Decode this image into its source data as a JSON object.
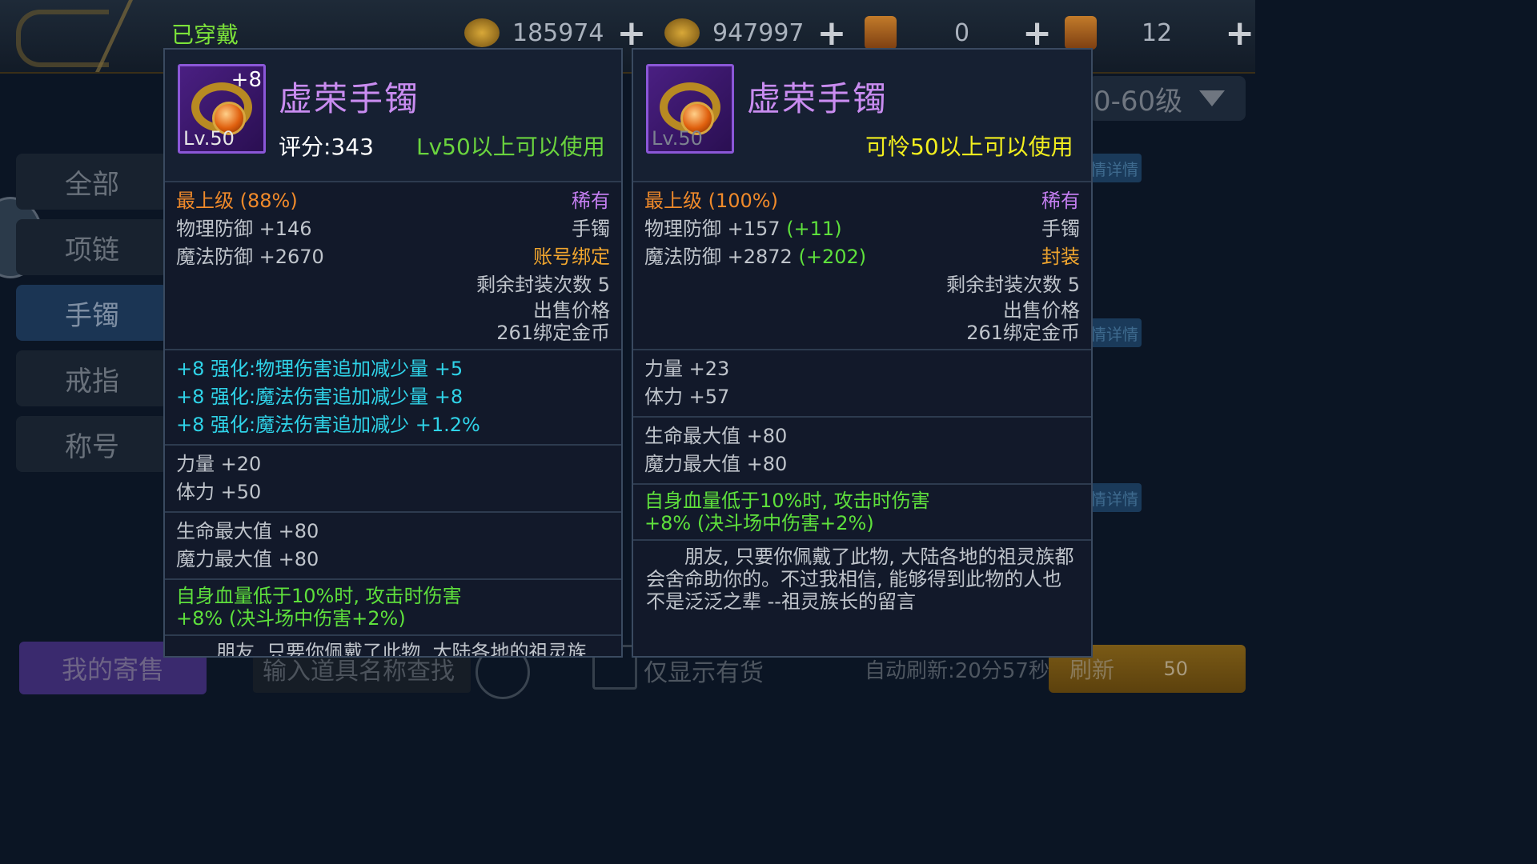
{
  "topbar": {
    "currencies": [
      {
        "icon": "gold-coin-icon",
        "value": "185974"
      },
      {
        "icon": "bound-coin-icon",
        "value": "947997"
      },
      {
        "icon": "scroll-icon",
        "value": "0"
      },
      {
        "icon": "scroll-icon",
        "value": "12"
      }
    ],
    "plus": "+"
  },
  "filter": {
    "level_range": "0-60级"
  },
  "side_tabs": [
    "全部",
    "项链",
    "手镯",
    "戒指",
    "称号"
  ],
  "active_tab_index": 2,
  "detail_button": "情详情",
  "bottom": {
    "my_consign": "我的寄售",
    "search_placeholder": "输入道具名称查找",
    "stock_only": "仅显示有货",
    "auto_refresh": "自动刷新:20分57秒",
    "refresh": "刷新",
    "refresh_cost": "50"
  },
  "equipped_label": "已穿戴",
  "left_item": {
    "name": "虚荣手镯",
    "level": "Lv.50",
    "enhance": "+8",
    "score": "评分:343",
    "use_level": "Lv50以上可以使用",
    "grade": "最上级 (88%)",
    "rarity": "稀有",
    "phys_def": "物理防御 +146",
    "type": "手镯",
    "mag_def": "魔法防御 +2670",
    "bind": "账号绑定",
    "remaining_seal": "剩余封装次数 5",
    "sell_label": "出售价格",
    "sell_price": "261绑定金币",
    "enhance_effects": [
      "+8 强化:物理伤害追加减少量 +5",
      "+8 强化:魔法伤害追加减少量 +8",
      "+8 强化:魔法伤害追加减少 +1.2%"
    ],
    "stats1": [
      "力量 +20",
      "体力 +50"
    ],
    "stats2": [
      "生命最大值 +80",
      "魔力最大值 +80"
    ],
    "special1": "自身血量低于10%时, 攻击时伤害",
    "special2": "+8% (决斗场中伤害+2%)",
    "lore": "朋友, 只要你佩戴了此物, 大陆各地的祖灵族"
  },
  "right_item": {
    "name": "虚荣手镯",
    "level": "Lv.50",
    "use_level": "可怜50以上可以使用",
    "grade": "最上级 (100%)",
    "rarity": "稀有",
    "phys_def": "物理防御 +157",
    "phys_def_diff": "(+11)",
    "type": "手镯",
    "mag_def": "魔法防御 +2872",
    "mag_def_diff": "(+202)",
    "bind": "封装",
    "remaining_seal": "剩余封装次数 5",
    "sell_label": "出售价格",
    "sell_price": "261绑定金币",
    "stats1": [
      "力量 +23",
      "体力 +57"
    ],
    "stats2": [
      "生命最大值 +80",
      "魔力最大值 +80"
    ],
    "special1": "自身血量低于10%时, 攻击时伤害",
    "special2": "+8% (决斗场中伤害+2%)",
    "lore": "朋友, 只要你佩戴了此物, 大陆各地的祖灵族都会舍命助你的。不过我相信, 能够得到此物的人也不是泛泛之辈 --祖灵族长的留言"
  }
}
